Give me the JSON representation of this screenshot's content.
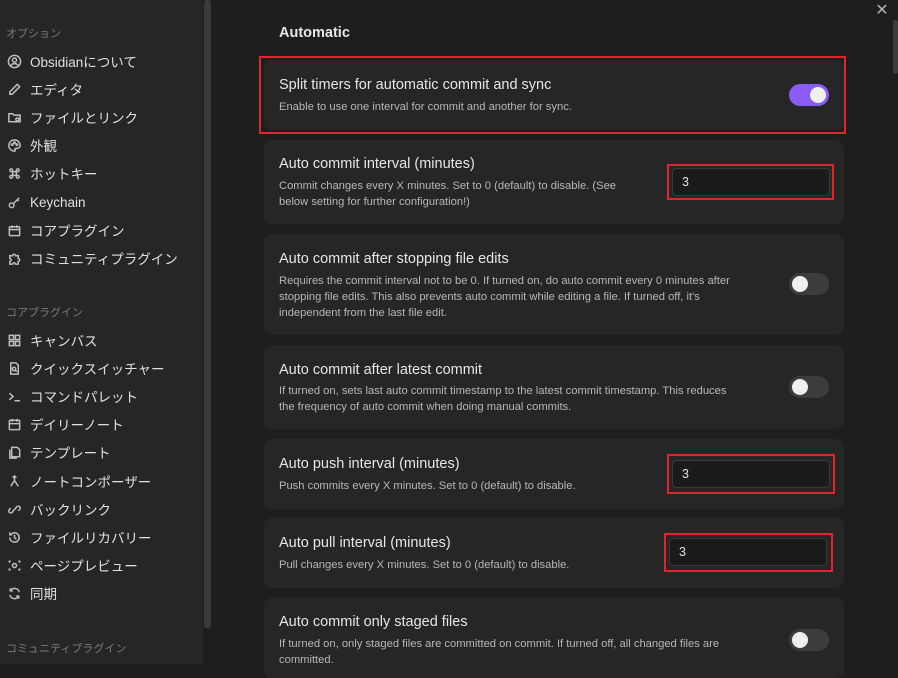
{
  "sidebar": {
    "options_header": "オプション",
    "options_items": [
      {
        "label": "Obsidianについて",
        "icon": "user-circle-icon"
      },
      {
        "label": "エディタ",
        "icon": "pencil-icon"
      },
      {
        "label": "ファイルとリンク",
        "icon": "folder-cog-icon"
      },
      {
        "label": "外観",
        "icon": "palette-icon"
      },
      {
        "label": "ホットキー",
        "icon": "command-icon"
      },
      {
        "label": "Keychain",
        "icon": "key-icon"
      },
      {
        "label": "コアプラグイン",
        "icon": "calendar-box-icon"
      },
      {
        "label": "コミュニティプラグイン",
        "icon": "puzzle-icon"
      }
    ],
    "core_header": "コアプラグイン",
    "core_items": [
      {
        "label": "キャンバス",
        "icon": "grid-icon"
      },
      {
        "label": "クイックスイッチャー",
        "icon": "file-search-icon"
      },
      {
        "label": "コマンドパレット",
        "icon": "terminal-icon"
      },
      {
        "label": "デイリーノート",
        "icon": "calendar-icon"
      },
      {
        "label": "テンプレート",
        "icon": "files-icon"
      },
      {
        "label": "ノートコンポーザー",
        "icon": "merge-icon"
      },
      {
        "label": "バックリンク",
        "icon": "link-icon"
      },
      {
        "label": "ファイルリカバリー",
        "icon": "history-icon"
      },
      {
        "label": "ページプレビュー",
        "icon": "eye-icon"
      },
      {
        "label": "同期",
        "icon": "sync-icon"
      }
    ],
    "community_header": "コミュニティプラグイン"
  },
  "main": {
    "section_title": "Automatic",
    "settings": [
      {
        "title": "Split timers for automatic commit and sync",
        "desc": "Enable to use one interval for commit and another for sync.",
        "control": "toggle",
        "toggle_on": true
      },
      {
        "title": "Auto commit interval (minutes)",
        "desc_lines": [
          "Commit changes every X minutes. Set to 0 (default) to disable. (See",
          "below setting for further configuration!)"
        ],
        "control": "input",
        "value": "3"
      },
      {
        "title": "Auto commit after stopping file edits",
        "desc_lines": [
          "Requires the commit interval not to be 0. If turned on, do auto commit every 0 minutes after",
          "stopping file edits. This also prevents auto commit while editing a file. If turned off, it's",
          "independent from the last file edit."
        ],
        "control": "toggle",
        "toggle_on": false
      },
      {
        "title": "Auto commit after latest commit",
        "desc_lines": [
          "If turned on, sets last auto commit timestamp to the latest commit timestamp. This reduces",
          "the frequency of auto commit when doing manual commits."
        ],
        "control": "toggle",
        "toggle_on": false
      },
      {
        "title": "Auto push interval (minutes)",
        "desc": "Push commits every X minutes. Set to 0 (default) to disable.",
        "control": "input",
        "value": "3"
      },
      {
        "title": "Auto pull interval (minutes)",
        "desc": "Pull changes every X minutes. Set to 0 (default) to disable.",
        "control": "input",
        "value": "3"
      },
      {
        "title": "Auto commit only staged files",
        "desc_lines": [
          "If turned on, only staged files are committed on commit. If turned off, all changed files are",
          "committed."
        ],
        "control": "toggle",
        "toggle_on": false
      }
    ]
  },
  "colors": {
    "accent": "#8a5cf5",
    "highlight": "#e0262b"
  }
}
